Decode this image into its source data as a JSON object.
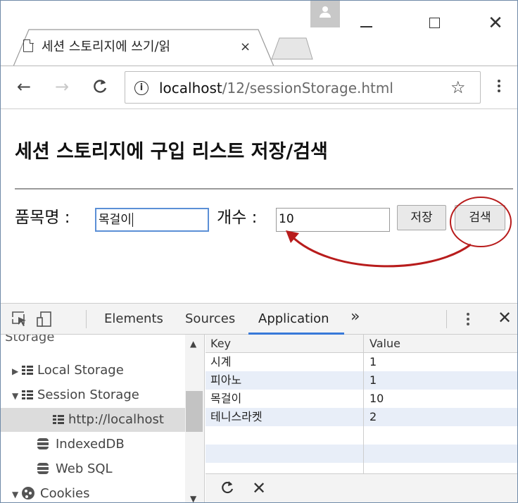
{
  "browser": {
    "tab_title": "세션 스토리지에 쓰기/읽",
    "tab_close": "×",
    "window_min": "—",
    "window_close": "✕",
    "back_icon": "←",
    "forward_icon": "→",
    "reload_icon": "C",
    "info_icon": "i",
    "url_host": "localhost",
    "url_path": "/12/sessionStorage.html",
    "bookmark_icon": "☆"
  },
  "page": {
    "heading": "세션 스토리지에 구입 리스트 저장/검색",
    "item_label": "품목명 :",
    "item_value": "목걸이",
    "count_label": "개수 :",
    "count_value": "10",
    "save_button": "저장",
    "search_button": "검색"
  },
  "devtools": {
    "tabs": [
      "Elements",
      "Sources",
      "Application"
    ],
    "active_tab": "Application",
    "more": "»",
    "close": "✕",
    "sidebar_header": "Storage",
    "sidebar": {
      "local_storage": "Local Storage",
      "session_storage": "Session Storage",
      "session_origin": "http://localhost",
      "indexeddb": "IndexedDB",
      "websql": "Web SQL",
      "cookies": "Cookies"
    },
    "table": {
      "headers": [
        "Key",
        "Value"
      ],
      "rows": [
        {
          "key": "시계",
          "value": "1"
        },
        {
          "key": "피아노",
          "value": "1"
        },
        {
          "key": "목걸이",
          "value": "10"
        },
        {
          "key": "테니스라켓",
          "value": "2"
        }
      ]
    },
    "refresh_icon": "C",
    "delete_icon": "✕"
  },
  "colors": {
    "accent": "#3879d9",
    "annotation": "#b81c1c",
    "selected_row": "#dcdcdc",
    "alt_row": "#e8eef8"
  }
}
